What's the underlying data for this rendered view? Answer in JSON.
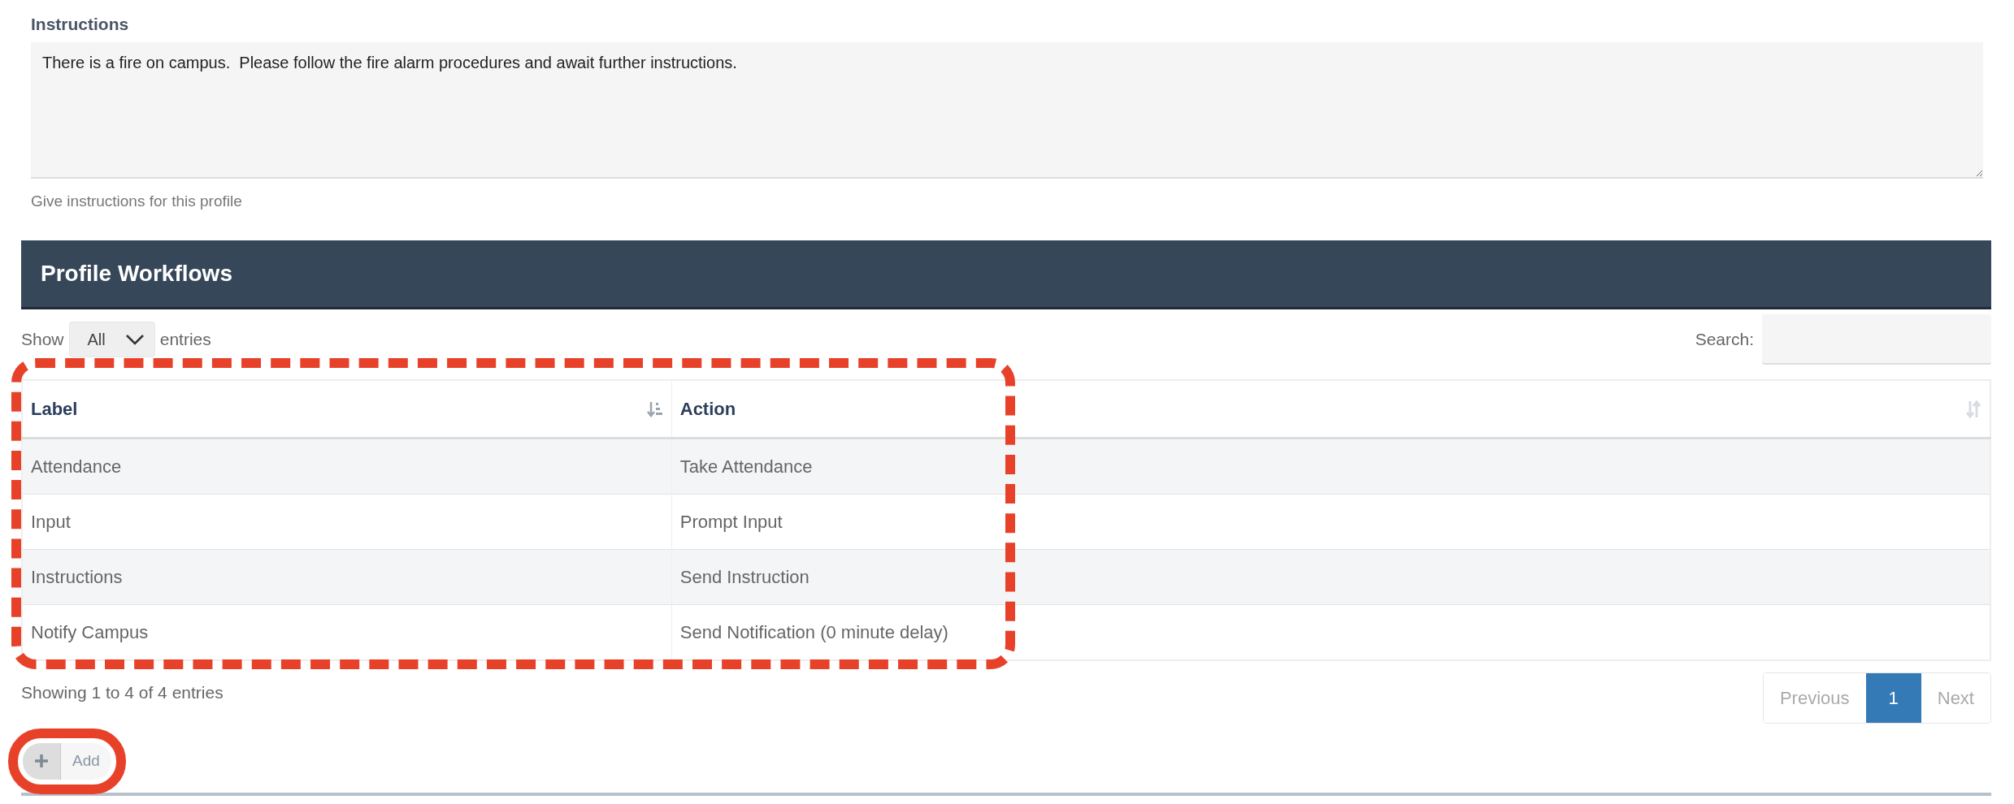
{
  "instructions": {
    "label": "Instructions",
    "value": "There is a fire on campus.  Please follow the fire alarm procedures and await further instructions.",
    "help": "Give instructions for this profile"
  },
  "panel": {
    "title": "Profile Workflows"
  },
  "length": {
    "before": "Show",
    "value": "All",
    "after": "entries"
  },
  "search": {
    "label": "Search:"
  },
  "table": {
    "outline": {
      "kind": "dashed"
    },
    "columns": [
      {
        "label": "Label",
        "kind": "sorted"
      },
      {
        "label": "Action",
        "kind": "sortable"
      }
    ],
    "rows": [
      [
        "Attendance",
        "Take Attendance"
      ],
      [
        "Input",
        "Prompt Input"
      ],
      [
        "Instructions",
        "Send Instruction"
      ],
      [
        "Notify Campus",
        "Send Notification (0 minute delay)"
      ]
    ]
  },
  "info": "Showing 1 to 4 of 4 entries",
  "pagination": [
    {
      "label": "Previous",
      "selected": false
    },
    {
      "label": "1",
      "selected": true
    },
    {
      "label": "Next",
      "selected": false
    }
  ],
  "add_button": {
    "label": "Add",
    "outline": {
      "kind": "solid"
    }
  }
}
